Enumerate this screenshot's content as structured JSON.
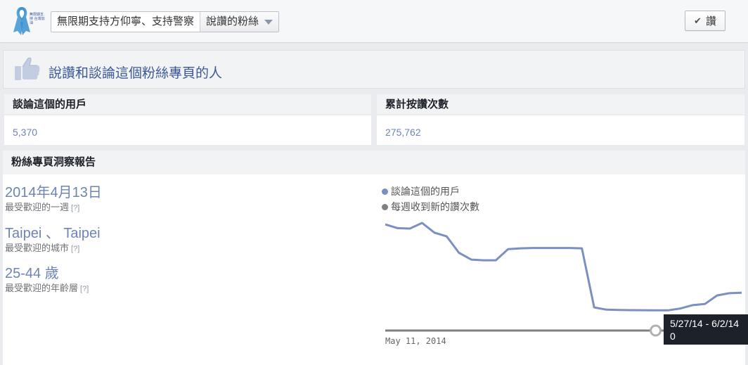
{
  "topbar": {
    "page_name": "無限期支持方仰寧、支持警察",
    "view_label": "說讚的粉絲",
    "like_button": "讚",
    "logo_caption": "無限期支持 台灣加油"
  },
  "like_header": {
    "title": "說讚和談論這個粉絲專頁的人"
  },
  "stats": [
    {
      "label": "談論這個的用戶",
      "value": "5,370"
    },
    {
      "label": "累計按讚次數",
      "value": "275,762"
    }
  ],
  "insights": {
    "title": "粉絲專頁洞察報告",
    "metrics": [
      {
        "value": "2014年4月13日",
        "caption": "最受歡迎的一週",
        "help": "[?]"
      },
      {
        "value": "Taipei 、 Taipei",
        "caption": "最受歡迎的城市",
        "help": "[?]"
      },
      {
        "value": "25-44 歲",
        "caption": "最受歡迎的年齡層",
        "help": "[?]"
      }
    ]
  },
  "colors": {
    "accent": "#3b5998",
    "link": "#6d84b4",
    "series1": "#7b8fc0",
    "series2": "#808080"
  },
  "chart_data": {
    "type": "line",
    "legend": [
      "談論這個的用戶",
      "每週收到新的讚次數"
    ],
    "x_label_first": "May 11, 2014",
    "tooltip_range": "5/27/14 - 6/2/14",
    "tooltip_value": "0",
    "series": [
      {
        "name": "談論這個的用戶",
        "values": [
          1420,
          1370,
          1365,
          1440,
          1310,
          1260,
          1040,
          950,
          940,
          940,
          1090,
          1100,
          1105,
          1105,
          1105,
          1105,
          1100,
          310,
          280,
          275,
          273,
          272,
          271,
          270,
          295,
          340,
          355,
          470,
          500,
          505
        ]
      },
      {
        "name": "每週收到新的讚次數",
        "values": [
          0,
          0,
          0,
          0,
          0,
          0,
          0,
          0,
          0,
          0,
          0,
          0,
          0,
          0,
          0,
          0,
          0,
          0,
          0,
          0,
          0,
          0,
          0,
          0,
          0,
          0,
          0,
          0,
          0,
          0
        ]
      }
    ],
    "ylim": [
      0,
      1600
    ]
  }
}
